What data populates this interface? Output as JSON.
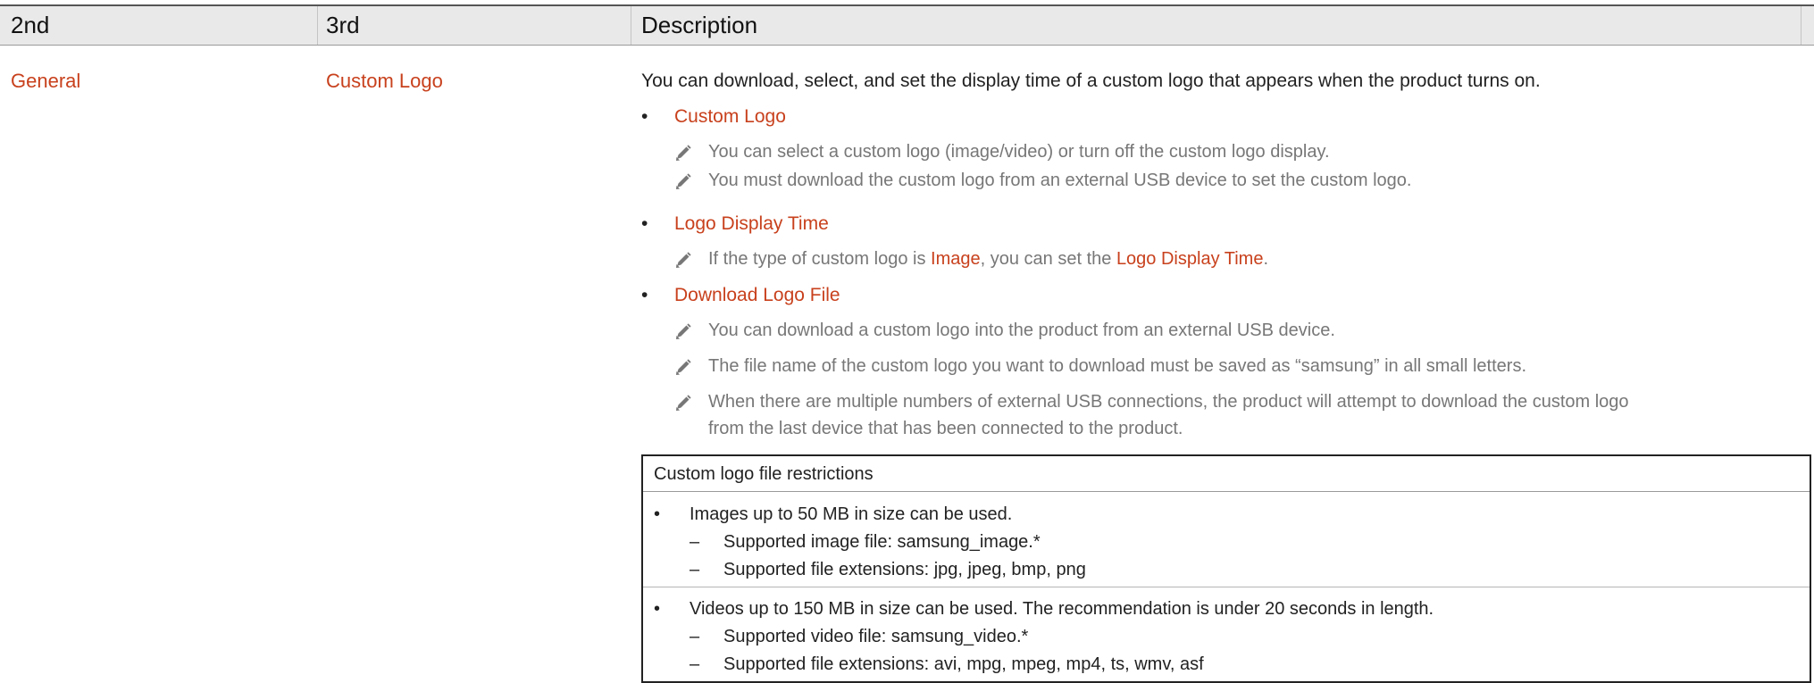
{
  "table": {
    "headers": [
      "2nd",
      "3rd",
      "Description"
    ],
    "row": {
      "second": "General",
      "third": "Custom Logo",
      "intro": "You can download, select, and set the display time of a custom logo that appears when the product turns on.",
      "items": [
        {
          "label": "Custom Logo",
          "notes": [
            "You can select a custom logo (image/video) or turn off the custom logo display.",
            "You must download the custom logo from an external USB device to set the custom logo."
          ]
        },
        {
          "label": "Logo Display Time",
          "note_parts": {
            "before": "If the type of custom logo is ",
            "highlight1": "Image",
            "middle": ", you can set the ",
            "highlight2": "Logo Display Time",
            "after": "."
          }
        },
        {
          "label": "Download Logo File",
          "notes": [
            "You can download a custom logo into the product from an external USB device.",
            "The file name of the custom logo you want to download must be saved as “samsung” in all small letters.",
            "When there are multiple numbers of external USB connections, the product will attempt to download the custom logo",
            "from the last device that has been connected to the product."
          ]
        }
      ]
    }
  },
  "restrictions": {
    "title": "Custom logo file restrictions",
    "images": {
      "text": "Images up to 50 MB in size can be used.",
      "subs": [
        "Supported image file: samsung_image.*",
        "Supported file extensions: jpg, jpeg, bmp, png"
      ]
    },
    "videos": {
      "text": "Videos up to 150 MB in size can be used. The recommendation is under 20 seconds in length.",
      "subs": [
        "Supported video file: samsung_video.*",
        "Supported file extensions: avi, mpg, mpeg, mp4, ts, wmv, asf"
      ]
    }
  },
  "symbols": {
    "bullet": "•",
    "dash": "–"
  },
  "icons": {
    "note": "pencil-icon"
  },
  "colors": {
    "accent": "#c8411d",
    "note_text": "#777777"
  }
}
